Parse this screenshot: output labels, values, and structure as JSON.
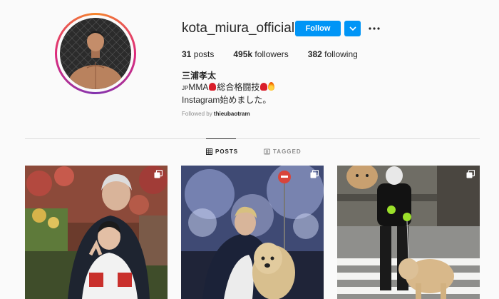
{
  "profile": {
    "username": "kota_miura_official",
    "follow_label": "Follow",
    "stats": {
      "posts_count": "31",
      "posts_label": " posts",
      "followers_count": "495k",
      "followers_label": " followers",
      "following_count": "382",
      "following_label": " following"
    },
    "full_name": "三浦孝太",
    "bio_line1_prefix": "JP",
    "bio_line1_text": "MMA",
    "bio_line1_text2": "総合格闘技",
    "bio_line2": "Instagram始めました。",
    "followed_by_label": "Followed by ",
    "followed_by_user": "thieubaotram"
  },
  "tabs": [
    {
      "label": "POSTS",
      "icon": "grid-icon",
      "active": true
    },
    {
      "label": "TAGGED",
      "icon": "tag-icon",
      "active": false
    }
  ],
  "colors": {
    "accent": "#0095f6",
    "text": "#262626",
    "muted": "#8e8e8e",
    "divider": "#dbdbdb",
    "background": "#fafafa"
  },
  "posts": [
    {
      "name": "post-elder-and-boy",
      "multi": true
    },
    {
      "name": "post-night-lights-with-dog",
      "multi": true
    },
    {
      "name": "post-walking-dog-crosswalk",
      "multi": true
    }
  ]
}
